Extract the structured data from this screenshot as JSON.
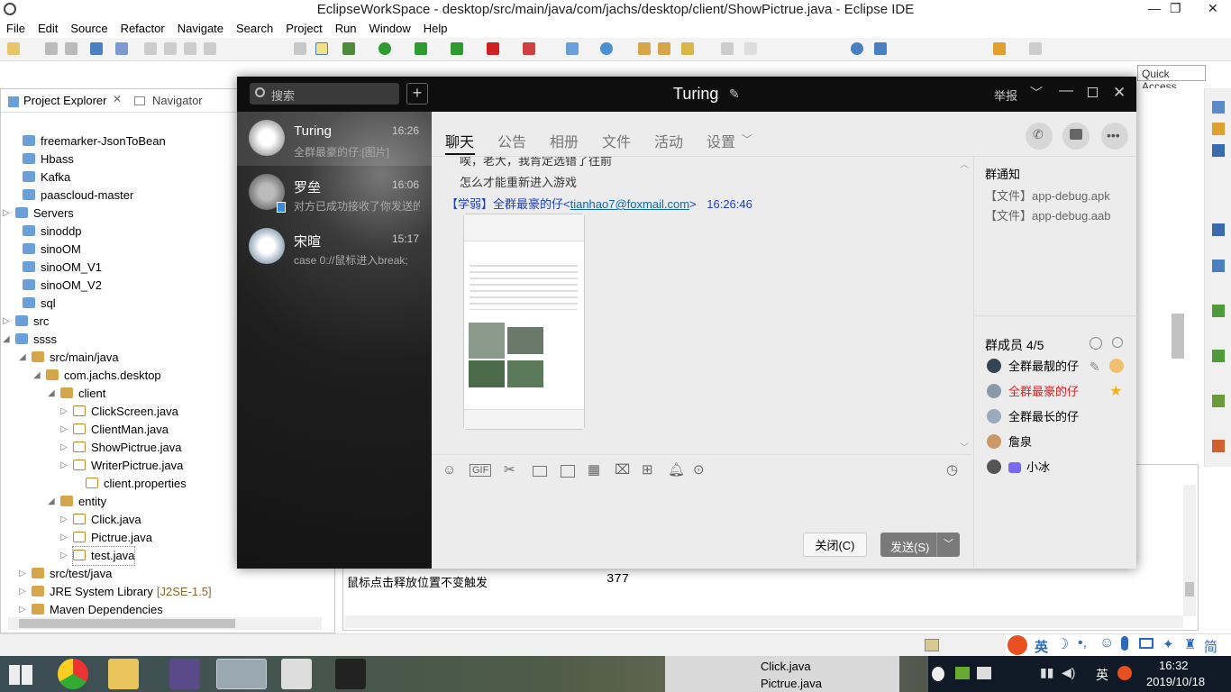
{
  "eclipse": {
    "title": "EclipseWorkSpace - desktop/src/main/java/com/jachs/desktop/client/ShowPictrue.java - Eclipse IDE",
    "menu": [
      "File",
      "Edit",
      "Source",
      "Refactor",
      "Navigate",
      "Search",
      "Project",
      "Run",
      "Window",
      "Help"
    ],
    "quick_access": "Quick Access",
    "explorer_tab": "Project Explorer",
    "navigator_tab": "Navigator",
    "tree": [
      {
        "label": "freemarker-JsonToBean",
        "suffix": ""
      },
      {
        "label": "Hbass",
        "suffix": ""
      },
      {
        "label": "Kafka",
        "suffix": ""
      },
      {
        "label": "paascloud-master",
        "suffix": ""
      },
      {
        "label": "Servers",
        "suffix": ""
      },
      {
        "label": "sinoddp",
        "suffix": ""
      },
      {
        "label": "sinoOM",
        "suffix": ""
      },
      {
        "label": "sinoOM_V1",
        "suffix": ""
      },
      {
        "label": "sinoOM_V2",
        "suffix": ""
      },
      {
        "label": "sql",
        "suffix": ""
      },
      {
        "label": "src",
        "suffix": ""
      },
      {
        "label": "ssss",
        "suffix": ""
      },
      {
        "label": "src/main/java",
        "suffix": ""
      },
      {
        "label": "com.jachs.desktop",
        "suffix": ""
      },
      {
        "label": "client",
        "suffix": ""
      },
      {
        "label": "ClickScreen.java",
        "suffix": ""
      },
      {
        "label": "ClientMan.java",
        "suffix": ""
      },
      {
        "label": "ShowPictrue.java",
        "suffix": ""
      },
      {
        "label": "WriterPictrue.java",
        "suffix": ""
      },
      {
        "label": "client.properties",
        "suffix": ""
      },
      {
        "label": "entity",
        "suffix": ""
      },
      {
        "label": "Click.java",
        "suffix": ""
      },
      {
        "label": "Pictrue.java",
        "suffix": ""
      },
      {
        "label": "test.java",
        "suffix": ""
      },
      {
        "label": "src/test/java",
        "suffix": ""
      },
      {
        "label": "JRE System Library",
        "suffix": "[J2SE-1.5]"
      },
      {
        "label": "Maven Dependencies",
        "suffix": ""
      }
    ],
    "console_line": "鼠标点击释放位置不变触发",
    "console_value": "377"
  },
  "qq": {
    "search_placeholder": "搜索",
    "chat_title": "Turing",
    "report": "举报",
    "conversations": [
      {
        "name": "Turing",
        "time": "16:26",
        "preview": "全群最豪的仔:[图片]"
      },
      {
        "name": "罗垒",
        "time": "16:06",
        "preview": "对方已成功接收了你发送的"
      },
      {
        "name": "宋暄",
        "time": "15:17",
        "preview": "case 0://鼠标进入break;"
      }
    ],
    "tabs": [
      "聊天",
      "公告",
      "相册",
      "文件",
      "活动",
      "设置"
    ],
    "messages": {
      "prev1": "唉，老大，我肯定选错了往前",
      "prev2": "怎么才能重新进入游戏",
      "sender_prefix": "【学弱】全群最豪的仔<",
      "sender_email": "tianhao7@foxmail.com",
      "sender_suffix": ">",
      "sender_time": "16:26:46"
    },
    "notice_title": "群通知",
    "notices": [
      "【文件】app-debug.apk",
      "【文件】app-debug.aab"
    ],
    "members_title": "群成员 4/5",
    "members": [
      {
        "name": "全群最靓的仔",
        "color": "#222"
      },
      {
        "name": "全群最豪的仔",
        "color": "#e02020"
      },
      {
        "name": "全群最长的仔",
        "color": "#222"
      },
      {
        "name": "詹泉",
        "color": "#222"
      },
      {
        "name": "小冰",
        "color": "#222"
      }
    ],
    "close_button": "关闭(C)",
    "send_button": "发送(S)"
  },
  "taskbar": {
    "time": "16:32",
    "date": "2019/10/18",
    "ime": "英",
    "popup_items": [
      "Click.java",
      "Pictrue.java"
    ]
  }
}
